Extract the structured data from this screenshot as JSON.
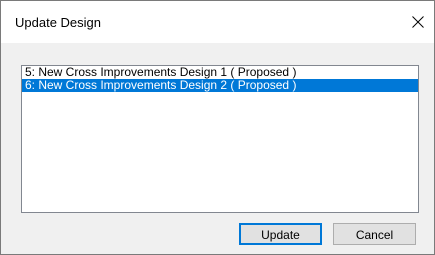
{
  "window": {
    "title": "Update Design",
    "close_icon": "close-icon"
  },
  "designs": {
    "items": [
      {
        "label": "5: New Cross Improvements Design 1 ( Proposed )",
        "selected": false
      },
      {
        "label": "6: New Cross Improvements Design 2 ( Proposed )",
        "selected": true
      }
    ]
  },
  "buttons": {
    "update_label": "Update",
    "cancel_label": "Cancel"
  },
  "colors": {
    "selection": "#0078d7",
    "dialog_background": "#f0f0f0",
    "titlebar_background": "#ffffff"
  }
}
